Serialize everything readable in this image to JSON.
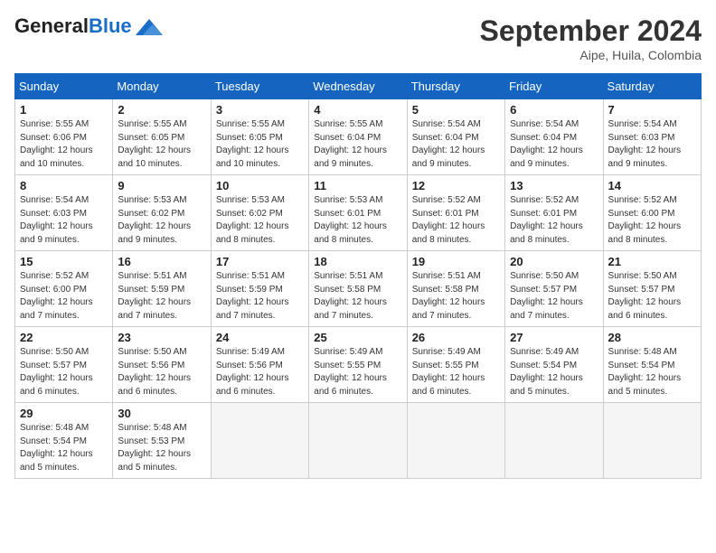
{
  "header": {
    "logo_general": "General",
    "logo_blue": "Blue",
    "month_title": "September 2024",
    "subtitle": "Aipe, Huila, Colombia"
  },
  "weekdays": [
    "Sunday",
    "Monday",
    "Tuesday",
    "Wednesday",
    "Thursday",
    "Friday",
    "Saturday"
  ],
  "weeks": [
    [
      {
        "day": "1",
        "info": "Sunrise: 5:55 AM\nSunset: 6:06 PM\nDaylight: 12 hours\nand 10 minutes."
      },
      {
        "day": "2",
        "info": "Sunrise: 5:55 AM\nSunset: 6:05 PM\nDaylight: 12 hours\nand 10 minutes."
      },
      {
        "day": "3",
        "info": "Sunrise: 5:55 AM\nSunset: 6:05 PM\nDaylight: 12 hours\nand 10 minutes."
      },
      {
        "day": "4",
        "info": "Sunrise: 5:55 AM\nSunset: 6:04 PM\nDaylight: 12 hours\nand 9 minutes."
      },
      {
        "day": "5",
        "info": "Sunrise: 5:54 AM\nSunset: 6:04 PM\nDaylight: 12 hours\nand 9 minutes."
      },
      {
        "day": "6",
        "info": "Sunrise: 5:54 AM\nSunset: 6:04 PM\nDaylight: 12 hours\nand 9 minutes."
      },
      {
        "day": "7",
        "info": "Sunrise: 5:54 AM\nSunset: 6:03 PM\nDaylight: 12 hours\nand 9 minutes."
      }
    ],
    [
      {
        "day": "8",
        "info": "Sunrise: 5:54 AM\nSunset: 6:03 PM\nDaylight: 12 hours\nand 9 minutes."
      },
      {
        "day": "9",
        "info": "Sunrise: 5:53 AM\nSunset: 6:02 PM\nDaylight: 12 hours\nand 9 minutes."
      },
      {
        "day": "10",
        "info": "Sunrise: 5:53 AM\nSunset: 6:02 PM\nDaylight: 12 hours\nand 8 minutes."
      },
      {
        "day": "11",
        "info": "Sunrise: 5:53 AM\nSunset: 6:01 PM\nDaylight: 12 hours\nand 8 minutes."
      },
      {
        "day": "12",
        "info": "Sunrise: 5:52 AM\nSunset: 6:01 PM\nDaylight: 12 hours\nand 8 minutes."
      },
      {
        "day": "13",
        "info": "Sunrise: 5:52 AM\nSunset: 6:01 PM\nDaylight: 12 hours\nand 8 minutes."
      },
      {
        "day": "14",
        "info": "Sunrise: 5:52 AM\nSunset: 6:00 PM\nDaylight: 12 hours\nand 8 minutes."
      }
    ],
    [
      {
        "day": "15",
        "info": "Sunrise: 5:52 AM\nSunset: 6:00 PM\nDaylight: 12 hours\nand 7 minutes."
      },
      {
        "day": "16",
        "info": "Sunrise: 5:51 AM\nSunset: 5:59 PM\nDaylight: 12 hours\nand 7 minutes."
      },
      {
        "day": "17",
        "info": "Sunrise: 5:51 AM\nSunset: 5:59 PM\nDaylight: 12 hours\nand 7 minutes."
      },
      {
        "day": "18",
        "info": "Sunrise: 5:51 AM\nSunset: 5:58 PM\nDaylight: 12 hours\nand 7 minutes."
      },
      {
        "day": "19",
        "info": "Sunrise: 5:51 AM\nSunset: 5:58 PM\nDaylight: 12 hours\nand 7 minutes."
      },
      {
        "day": "20",
        "info": "Sunrise: 5:50 AM\nSunset: 5:57 PM\nDaylight: 12 hours\nand 7 minutes."
      },
      {
        "day": "21",
        "info": "Sunrise: 5:50 AM\nSunset: 5:57 PM\nDaylight: 12 hours\nand 6 minutes."
      }
    ],
    [
      {
        "day": "22",
        "info": "Sunrise: 5:50 AM\nSunset: 5:57 PM\nDaylight: 12 hours\nand 6 minutes."
      },
      {
        "day": "23",
        "info": "Sunrise: 5:50 AM\nSunset: 5:56 PM\nDaylight: 12 hours\nand 6 minutes."
      },
      {
        "day": "24",
        "info": "Sunrise: 5:49 AM\nSunset: 5:56 PM\nDaylight: 12 hours\nand 6 minutes."
      },
      {
        "day": "25",
        "info": "Sunrise: 5:49 AM\nSunset: 5:55 PM\nDaylight: 12 hours\nand 6 minutes."
      },
      {
        "day": "26",
        "info": "Sunrise: 5:49 AM\nSunset: 5:55 PM\nDaylight: 12 hours\nand 6 minutes."
      },
      {
        "day": "27",
        "info": "Sunrise: 5:49 AM\nSunset: 5:54 PM\nDaylight: 12 hours\nand 5 minutes."
      },
      {
        "day": "28",
        "info": "Sunrise: 5:48 AM\nSunset: 5:54 PM\nDaylight: 12 hours\nand 5 minutes."
      }
    ],
    [
      {
        "day": "29",
        "info": "Sunrise: 5:48 AM\nSunset: 5:54 PM\nDaylight: 12 hours\nand 5 minutes."
      },
      {
        "day": "30",
        "info": "Sunrise: 5:48 AM\nSunset: 5:53 PM\nDaylight: 12 hours\nand 5 minutes."
      },
      {
        "day": "",
        "info": ""
      },
      {
        "day": "",
        "info": ""
      },
      {
        "day": "",
        "info": ""
      },
      {
        "day": "",
        "info": ""
      },
      {
        "day": "",
        "info": ""
      }
    ]
  ]
}
